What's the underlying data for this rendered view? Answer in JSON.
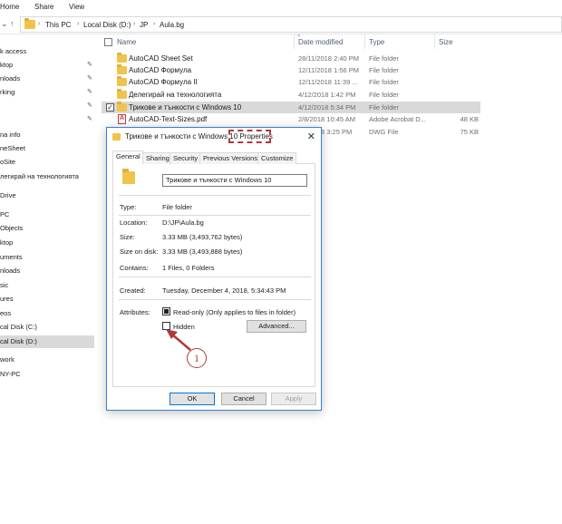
{
  "ribbon": {
    "tabs": [
      "Home",
      "Share",
      "View"
    ]
  },
  "address": {
    "crumbs": [
      "This PC",
      "Local Disk (D:)",
      "JP",
      "Aula.bg"
    ]
  },
  "navpane": {
    "items": [
      {
        "label": "k access",
        "pinned": false
      },
      {
        "label": "ktop",
        "pinned": true
      },
      {
        "label": "nloads",
        "pinned": true
      },
      {
        "label": "rking",
        "pinned": true
      },
      {
        "label": "",
        "pinned": true
      },
      {
        "label": "",
        "pinned": true
      },
      {
        "label": "na info",
        "pinned": false
      },
      {
        "label": "neSheet",
        "pinned": false
      },
      {
        "label": "oSite",
        "pinned": false
      },
      {
        "label": "легирай на технологията",
        "pinned": false
      },
      {
        "label": "Drive",
        "pinned": false
      },
      {
        "label": "PC",
        "pinned": false
      },
      {
        "label": "Objects",
        "pinned": false
      },
      {
        "label": "ktop",
        "pinned": false
      },
      {
        "label": "uments",
        "pinned": false
      },
      {
        "label": "nloads",
        "pinned": false
      },
      {
        "label": "sic",
        "pinned": false
      },
      {
        "label": "ures",
        "pinned": false
      },
      {
        "label": "eos",
        "pinned": false
      },
      {
        "label": "cal Disk (C:)",
        "pinned": false
      },
      {
        "label": "cal Disk (D:)",
        "pinned": false
      },
      {
        "label": "work",
        "pinned": false
      },
      {
        "label": "NY-PC",
        "pinned": false
      }
    ]
  },
  "filelist": {
    "headers": {
      "name": "Name",
      "date": "Date modified",
      "type": "Type",
      "size": "Size"
    },
    "rows": [
      {
        "name": "AutoCAD Sheet Set",
        "date": "28/11/2018 2:40 PM",
        "type": "File folder",
        "size": "",
        "icon": "folder-icon"
      },
      {
        "name": "AutoCAD Формула",
        "date": "12/11/2018 1:56 PM",
        "type": "File folder",
        "size": "",
        "icon": "folder-icon"
      },
      {
        "name": "AutoCAD Формула II",
        "date": "12/11/2018 11:39 ...",
        "type": "File folder",
        "size": "",
        "icon": "folder-icon"
      },
      {
        "name": "Делегирай на технологията",
        "date": "4/12/2018 1:42 PM",
        "type": "File folder",
        "size": "",
        "icon": "folder-icon"
      },
      {
        "name": "Трикове и тънкости с Windows 10",
        "date": "4/12/2018 5:34 PM",
        "type": "File folder",
        "size": "",
        "icon": "folder-icon",
        "checkmark": "✓"
      },
      {
        "name": "AutoCAD-Text-Sizes.pdf",
        "date": "2/8/2018 10:45 AM",
        "type": "Adobe Acrobat D...",
        "size": "48 KB",
        "icon": "pdf-icon"
      },
      {
        "name": "",
        "date": "2/8/2018 3:25 PM",
        "type": "DWG File",
        "size": "75 KB",
        "icon": ""
      }
    ]
  },
  "dialog": {
    "title": "Трикове и тънкости с Windows 10",
    "title_suffix": "Properties",
    "close_glyph": "✕",
    "tabs": [
      "General",
      "Sharing",
      "Security",
      "Previous Versions",
      "Customize"
    ],
    "folder_name": "Трикове и тънкости с Windows 10",
    "props": [
      {
        "label": "Type:",
        "value": "File folder"
      },
      {
        "label": "Location:",
        "value": "D:\\JP\\Aula.bg"
      },
      {
        "label": "Size:",
        "value": "3.33 MB (3,493,762 bytes)"
      },
      {
        "label": "Size on disk:",
        "value": "3.33 MB (3,493,888 bytes)"
      },
      {
        "label": "Contains:",
        "value": "1 Files, 0 Folders"
      },
      {
        "label": "Created:",
        "value": "Tuesday, December 4, 2018, 5:34:43 PM"
      },
      {
        "label": "Attributes:",
        "value": ""
      }
    ],
    "attributes": {
      "readonly_label": "Read-only (Only applies to files in folder)",
      "readonly_state": "indeterminate",
      "hidden_label": "Hidden",
      "hidden_checked": false,
      "advanced_label": "Advanced..."
    },
    "buttons": {
      "ok": "OK",
      "cancel": "Cancel",
      "apply": "Apply"
    }
  },
  "annotation": {
    "badge": "1",
    "color": "#b03a3a"
  }
}
